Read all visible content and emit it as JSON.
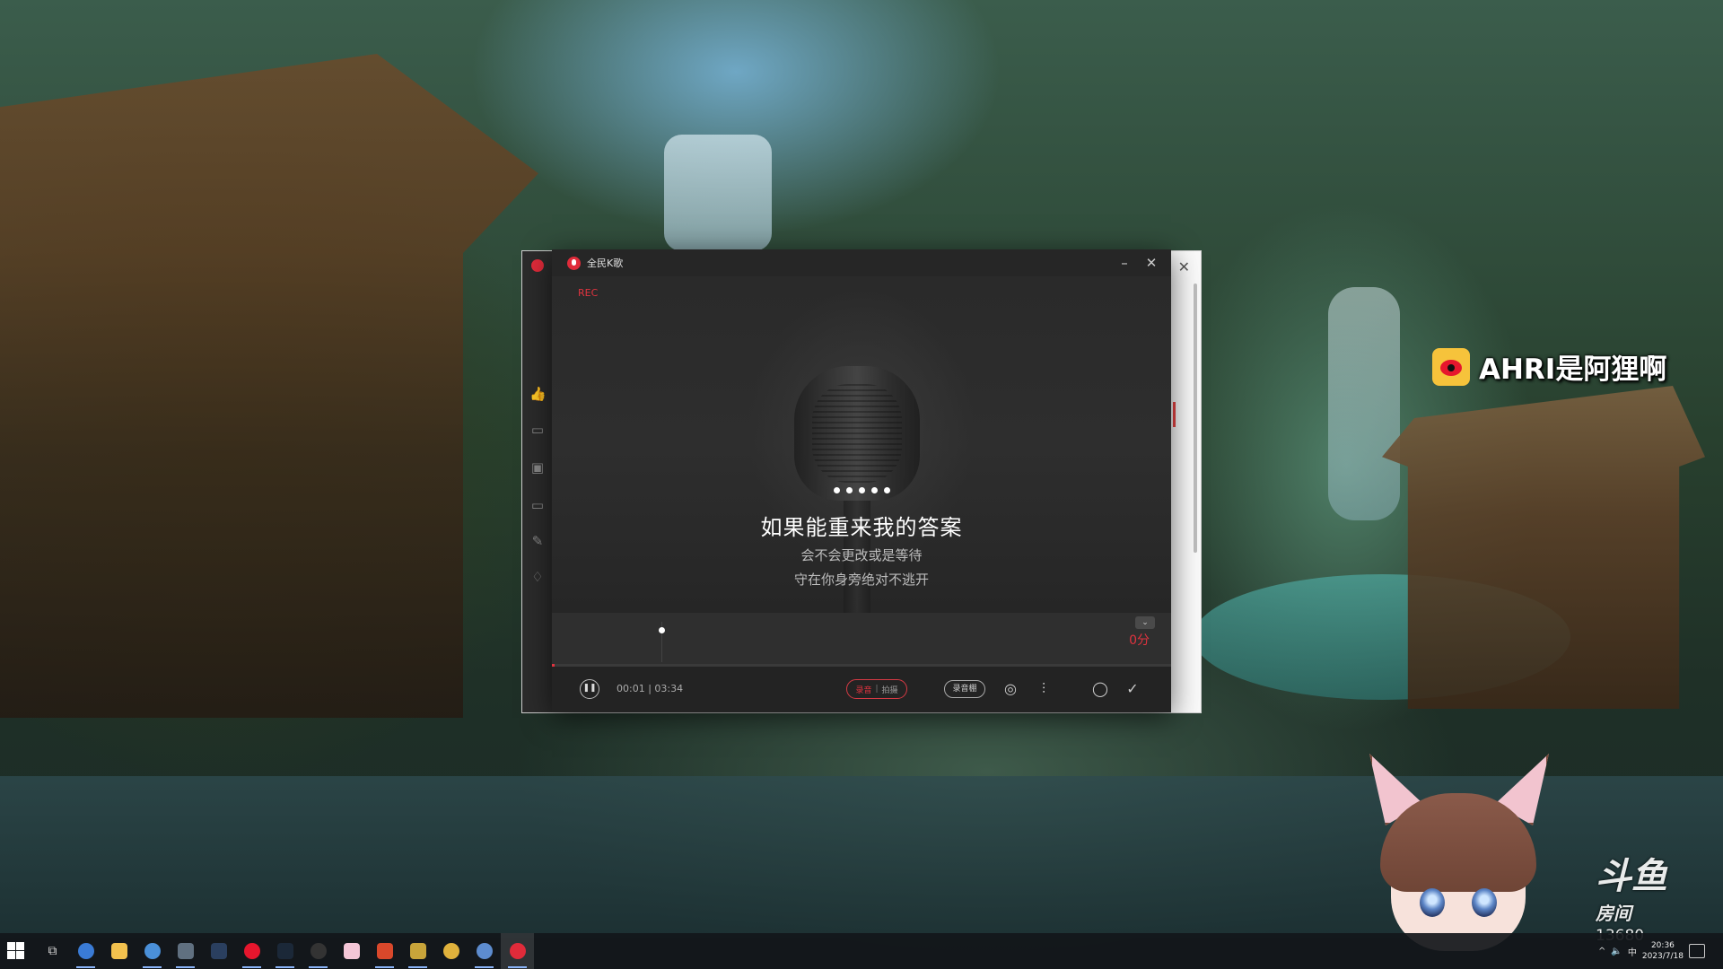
{
  "karaoke_window": {
    "app_title": "全民K歌",
    "rec_label": "REC",
    "minimize_glyph": "–",
    "close_glyph": "✕",
    "lyrics": {
      "current": "如果能重来我的答案",
      "next_1": "会不会更改或是等待",
      "next_2": "守在你身旁绝对不逃开"
    },
    "score_text": "0分",
    "collapse_glyph": "⌄",
    "progress_fraction": 0.005,
    "time": {
      "current": "00:01",
      "separator": "|",
      "total": "03:34"
    },
    "mode_toggle": {
      "active": "录音",
      "separator": "|",
      "inactive": "拍摄"
    },
    "studio_button": "录音棚",
    "icons": {
      "play_pause": "pause-icon",
      "camera": "camera-icon",
      "equalizer": "equalizer-icon",
      "restart": "restart-icon",
      "finish": "check-icon"
    }
  },
  "back_window": {
    "close_glyph": "✕",
    "sidebar_icons": [
      "thumbs-up-icon",
      "comment-icon",
      "video-icon",
      "monitor-icon",
      "edit-icon",
      "gift-icon"
    ]
  },
  "overlay": {
    "weibo_name": "AHRI是阿狸啊",
    "douyu_logo": "斗鱼",
    "douyu_room": "房间",
    "room_id": "13680"
  },
  "taskbar": {
    "apps": [
      "start-icon",
      "task-view-icon",
      "app-icon",
      "file-explorer-icon",
      "browser-icon",
      "settings-icon",
      "steam-icon",
      "weibo-app-icon",
      "game-icon",
      "app-icon",
      "photo-icon",
      "media-icon",
      "game-icon",
      "disk-icon",
      "browser-icon",
      "karaoke-app-icon"
    ],
    "clock_time": "20:36",
    "clock_date": "2023/7/18",
    "ime": "中"
  },
  "colors": {
    "accent_red": "#e0333f",
    "window_bg": "#232323",
    "taskbar_bg": "#12161a"
  }
}
